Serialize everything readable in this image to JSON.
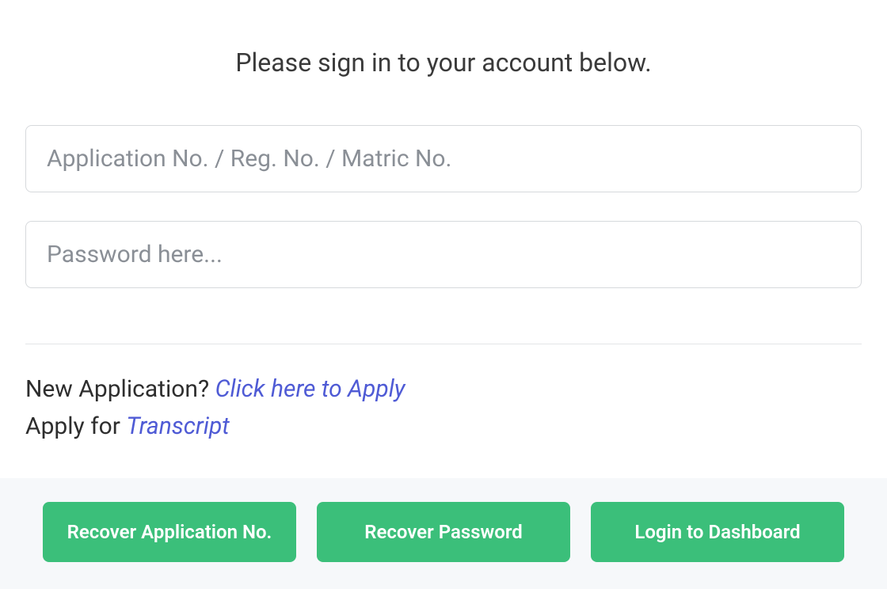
{
  "title": "Please sign in to your account below.",
  "inputs": {
    "identifier": {
      "placeholder": "Application No. / Reg. No. / Matric No.",
      "value": ""
    },
    "password": {
      "placeholder": "Password here...",
      "value": ""
    }
  },
  "links": {
    "new_application_prefix": "New Application? ",
    "new_application_link": "Click here to Apply",
    "transcript_prefix": "Apply for ",
    "transcript_link": "Transcript"
  },
  "buttons": {
    "recover_app_no": "Recover Application No.",
    "recover_password": "Recover Password",
    "login": "Login to Dashboard"
  }
}
